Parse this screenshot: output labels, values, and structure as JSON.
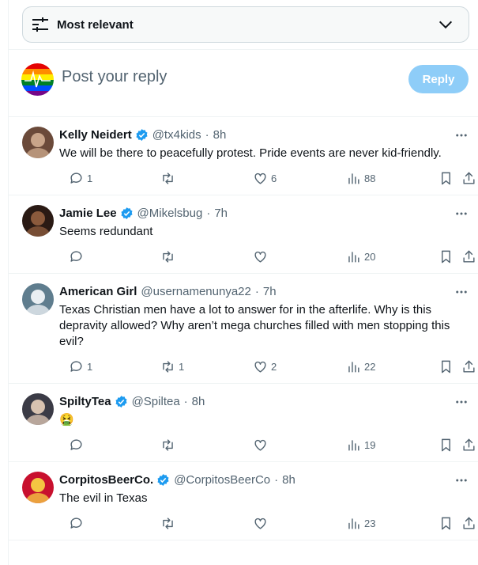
{
  "sort": {
    "label": "Most relevant"
  },
  "composer": {
    "placeholder": "Post your reply",
    "button": "Reply"
  },
  "replies": [
    {
      "name": "Kelly Neidert",
      "verified": true,
      "handle": "@tx4kids",
      "time": "8h",
      "text": "We will be there to peacefully protest. Pride events are never kid-friendly.",
      "replies": "1",
      "reposts": "",
      "likes": "6",
      "views": "88"
    },
    {
      "name": "Jamie Lee",
      "verified": true,
      "handle": "@Mikelsbug",
      "time": "7h",
      "text": "Seems redundant",
      "replies": "",
      "reposts": "",
      "likes": "",
      "views": "20"
    },
    {
      "name": "American Girl",
      "verified": false,
      "handle": "@usernamenunya22",
      "time": "7h",
      "text": "Texas Christian men have a lot to answer for in the afterlife. Why is this depravity allowed? Why aren’t mega churches filled with men stopping this evil?",
      "replies": "1",
      "reposts": "1",
      "likes": "2",
      "views": "22"
    },
    {
      "name": "SpiltyTea",
      "verified": true,
      "handle": "@Spiltea",
      "time": "8h",
      "text": "🤮",
      "replies": "",
      "reposts": "",
      "likes": "",
      "views": "19"
    },
    {
      "name": "CorpitosBeerCo.",
      "verified": true,
      "handle": "@CorpitosBeerCo",
      "time": "8h",
      "text": "The evil in Texas",
      "replies": "",
      "reposts": "",
      "likes": "",
      "views": "23"
    }
  ],
  "colors": {
    "accent": "#1d9bf0",
    "muted": "#536471",
    "reply_button": "#8ecdf8"
  }
}
